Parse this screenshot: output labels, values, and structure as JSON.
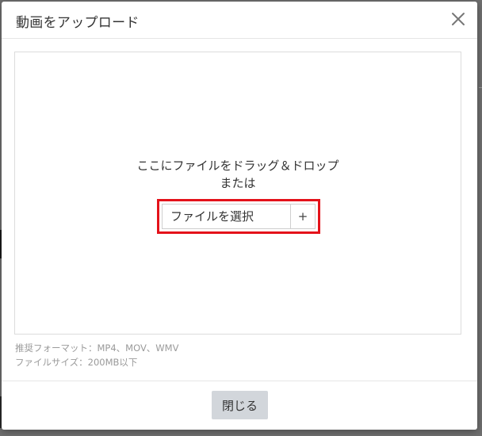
{
  "dialog": {
    "title": "動画をアップロード",
    "close_icon": "close-icon"
  },
  "dropzone": {
    "instruction_line1": "ここにファイルをドラッグ＆ドロップ",
    "instruction_line2": "または",
    "select_button_label": "ファイルを選択",
    "add_button_label": "+"
  },
  "notes": {
    "formats": "推奨フォーマット：MP4、MOV、WMV",
    "file_size": "ファイルサイズ：200MB以下"
  },
  "footer": {
    "close_label": "閉じる"
  },
  "colors": {
    "highlight": "#e4121a",
    "button_bg": "#d2d6db",
    "overlay": "#6f6f6f"
  }
}
